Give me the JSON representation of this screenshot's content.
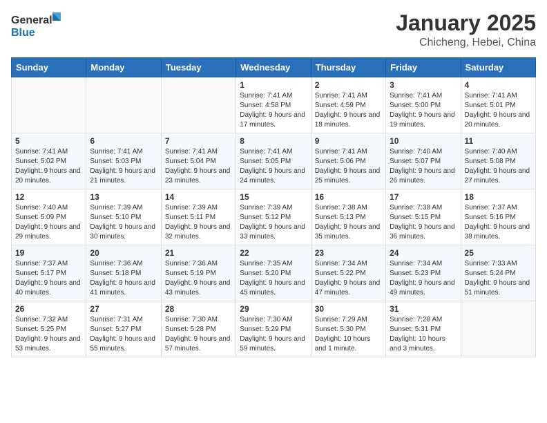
{
  "header": {
    "logo_general": "General",
    "logo_blue": "Blue",
    "month": "January 2025",
    "location": "Chicheng, Hebei, China"
  },
  "weekdays": [
    "Sunday",
    "Monday",
    "Tuesday",
    "Wednesday",
    "Thursday",
    "Friday",
    "Saturday"
  ],
  "weeks": [
    [
      {
        "day": "",
        "sunrise": "",
        "sunset": "",
        "daylight": ""
      },
      {
        "day": "",
        "sunrise": "",
        "sunset": "",
        "daylight": ""
      },
      {
        "day": "",
        "sunrise": "",
        "sunset": "",
        "daylight": ""
      },
      {
        "day": "1",
        "sunrise": "Sunrise: 7:41 AM",
        "sunset": "Sunset: 4:58 PM",
        "daylight": "Daylight: 9 hours and 17 minutes."
      },
      {
        "day": "2",
        "sunrise": "Sunrise: 7:41 AM",
        "sunset": "Sunset: 4:59 PM",
        "daylight": "Daylight: 9 hours and 18 minutes."
      },
      {
        "day": "3",
        "sunrise": "Sunrise: 7:41 AM",
        "sunset": "Sunset: 5:00 PM",
        "daylight": "Daylight: 9 hours and 19 minutes."
      },
      {
        "day": "4",
        "sunrise": "Sunrise: 7:41 AM",
        "sunset": "Sunset: 5:01 PM",
        "daylight": "Daylight: 9 hours and 20 minutes."
      }
    ],
    [
      {
        "day": "5",
        "sunrise": "Sunrise: 7:41 AM",
        "sunset": "Sunset: 5:02 PM",
        "daylight": "Daylight: 9 hours and 20 minutes."
      },
      {
        "day": "6",
        "sunrise": "Sunrise: 7:41 AM",
        "sunset": "Sunset: 5:03 PM",
        "daylight": "Daylight: 9 hours and 21 minutes."
      },
      {
        "day": "7",
        "sunrise": "Sunrise: 7:41 AM",
        "sunset": "Sunset: 5:04 PM",
        "daylight": "Daylight: 9 hours and 23 minutes."
      },
      {
        "day": "8",
        "sunrise": "Sunrise: 7:41 AM",
        "sunset": "Sunset: 5:05 PM",
        "daylight": "Daylight: 9 hours and 24 minutes."
      },
      {
        "day": "9",
        "sunrise": "Sunrise: 7:41 AM",
        "sunset": "Sunset: 5:06 PM",
        "daylight": "Daylight: 9 hours and 25 minutes."
      },
      {
        "day": "10",
        "sunrise": "Sunrise: 7:40 AM",
        "sunset": "Sunset: 5:07 PM",
        "daylight": "Daylight: 9 hours and 26 minutes."
      },
      {
        "day": "11",
        "sunrise": "Sunrise: 7:40 AM",
        "sunset": "Sunset: 5:08 PM",
        "daylight": "Daylight: 9 hours and 27 minutes."
      }
    ],
    [
      {
        "day": "12",
        "sunrise": "Sunrise: 7:40 AM",
        "sunset": "Sunset: 5:09 PM",
        "daylight": "Daylight: 9 hours and 29 minutes."
      },
      {
        "day": "13",
        "sunrise": "Sunrise: 7:39 AM",
        "sunset": "Sunset: 5:10 PM",
        "daylight": "Daylight: 9 hours and 30 minutes."
      },
      {
        "day": "14",
        "sunrise": "Sunrise: 7:39 AM",
        "sunset": "Sunset: 5:11 PM",
        "daylight": "Daylight: 9 hours and 32 minutes."
      },
      {
        "day": "15",
        "sunrise": "Sunrise: 7:39 AM",
        "sunset": "Sunset: 5:12 PM",
        "daylight": "Daylight: 9 hours and 33 minutes."
      },
      {
        "day": "16",
        "sunrise": "Sunrise: 7:38 AM",
        "sunset": "Sunset: 5:13 PM",
        "daylight": "Daylight: 9 hours and 35 minutes."
      },
      {
        "day": "17",
        "sunrise": "Sunrise: 7:38 AM",
        "sunset": "Sunset: 5:15 PM",
        "daylight": "Daylight: 9 hours and 36 minutes."
      },
      {
        "day": "18",
        "sunrise": "Sunrise: 7:37 AM",
        "sunset": "Sunset: 5:16 PM",
        "daylight": "Daylight: 9 hours and 38 minutes."
      }
    ],
    [
      {
        "day": "19",
        "sunrise": "Sunrise: 7:37 AM",
        "sunset": "Sunset: 5:17 PM",
        "daylight": "Daylight: 9 hours and 40 minutes."
      },
      {
        "day": "20",
        "sunrise": "Sunrise: 7:36 AM",
        "sunset": "Sunset: 5:18 PM",
        "daylight": "Daylight: 9 hours and 41 minutes."
      },
      {
        "day": "21",
        "sunrise": "Sunrise: 7:36 AM",
        "sunset": "Sunset: 5:19 PM",
        "daylight": "Daylight: 9 hours and 43 minutes."
      },
      {
        "day": "22",
        "sunrise": "Sunrise: 7:35 AM",
        "sunset": "Sunset: 5:20 PM",
        "daylight": "Daylight: 9 hours and 45 minutes."
      },
      {
        "day": "23",
        "sunrise": "Sunrise: 7:34 AM",
        "sunset": "Sunset: 5:22 PM",
        "daylight": "Daylight: 9 hours and 47 minutes."
      },
      {
        "day": "24",
        "sunrise": "Sunrise: 7:34 AM",
        "sunset": "Sunset: 5:23 PM",
        "daylight": "Daylight: 9 hours and 49 minutes."
      },
      {
        "day": "25",
        "sunrise": "Sunrise: 7:33 AM",
        "sunset": "Sunset: 5:24 PM",
        "daylight": "Daylight: 9 hours and 51 minutes."
      }
    ],
    [
      {
        "day": "26",
        "sunrise": "Sunrise: 7:32 AM",
        "sunset": "Sunset: 5:25 PM",
        "daylight": "Daylight: 9 hours and 53 minutes."
      },
      {
        "day": "27",
        "sunrise": "Sunrise: 7:31 AM",
        "sunset": "Sunset: 5:27 PM",
        "daylight": "Daylight: 9 hours and 55 minutes."
      },
      {
        "day": "28",
        "sunrise": "Sunrise: 7:30 AM",
        "sunset": "Sunset: 5:28 PM",
        "daylight": "Daylight: 9 hours and 57 minutes."
      },
      {
        "day": "29",
        "sunrise": "Sunrise: 7:30 AM",
        "sunset": "Sunset: 5:29 PM",
        "daylight": "Daylight: 9 hours and 59 minutes."
      },
      {
        "day": "30",
        "sunrise": "Sunrise: 7:29 AM",
        "sunset": "Sunset: 5:30 PM",
        "daylight": "Daylight: 10 hours and 1 minute."
      },
      {
        "day": "31",
        "sunrise": "Sunrise: 7:28 AM",
        "sunset": "Sunset: 5:31 PM",
        "daylight": "Daylight: 10 hours and 3 minutes."
      },
      {
        "day": "",
        "sunrise": "",
        "sunset": "",
        "daylight": ""
      }
    ]
  ]
}
